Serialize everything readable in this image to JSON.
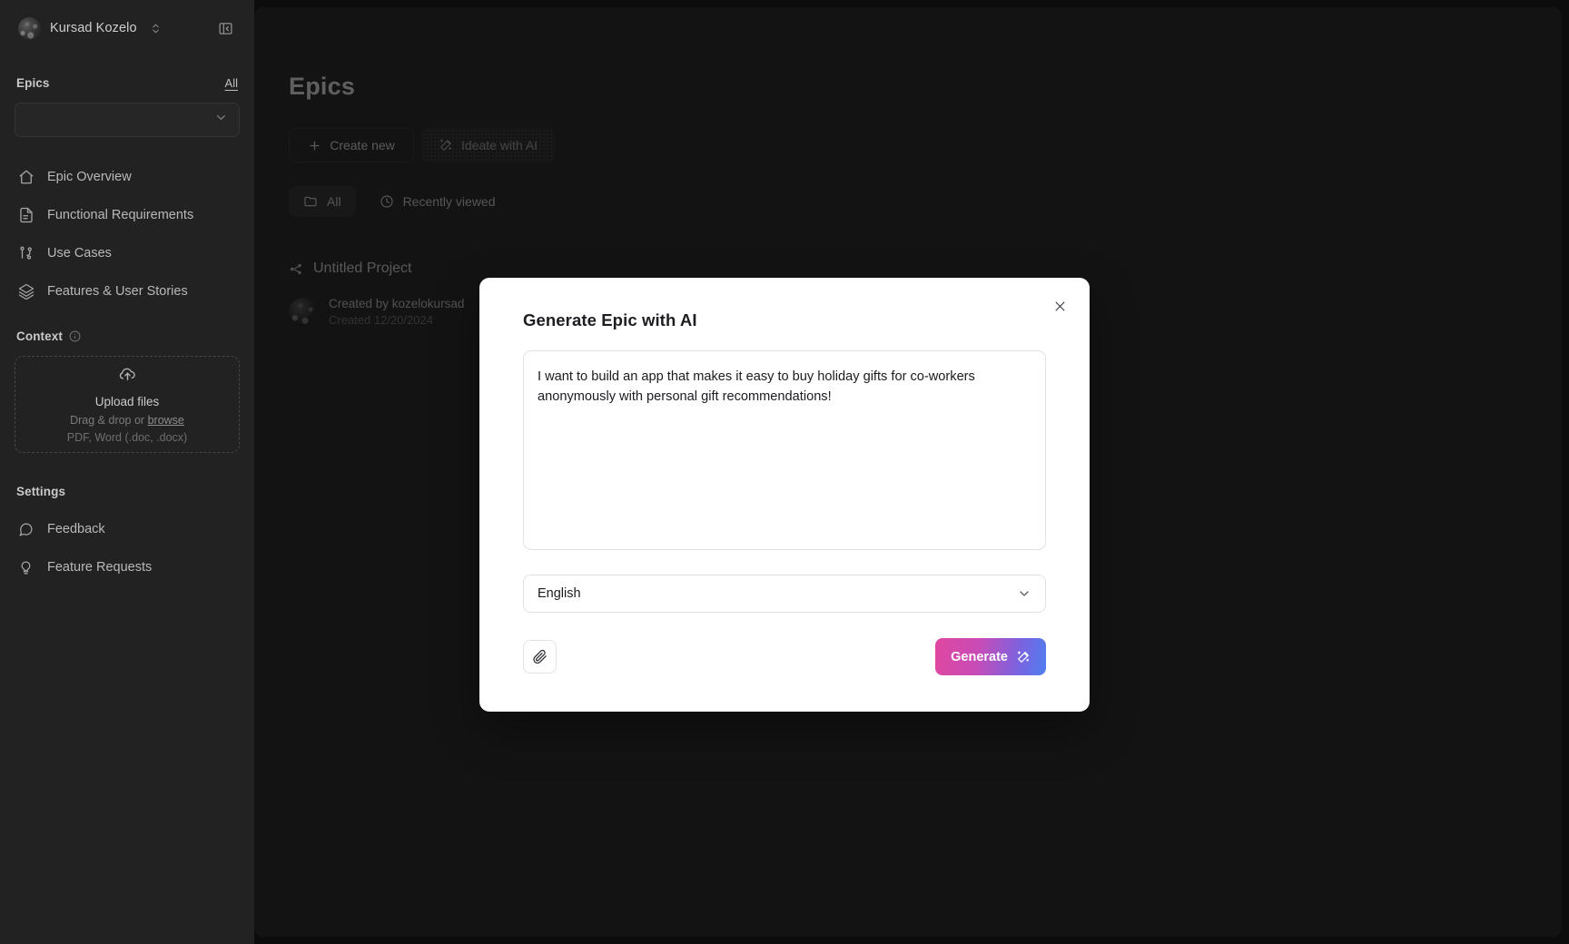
{
  "sidebar": {
    "user": {
      "name": "Kursad Kozelo",
      "avatar_icon": "user-avatar",
      "switcher_icon": "chevron-up-down-icon",
      "collapse_icon": "panel-collapse-icon"
    },
    "epics": {
      "label": "Epics",
      "all_link": "All",
      "select_value": "",
      "select_icon": "chevron-down-icon"
    },
    "nav_items": [
      {
        "label": "Epic Overview",
        "icon": "home-icon"
      },
      {
        "label": "Functional Requirements",
        "icon": "document-icon"
      },
      {
        "label": "Use Cases",
        "icon": "branch-icon"
      },
      {
        "label": "Features & User Stories",
        "icon": "layers-icon"
      }
    ],
    "context": {
      "label": "Context",
      "info_icon": "info-icon",
      "upload_icon": "cloud-upload-icon",
      "upload_title": "Upload files",
      "upload_hint_prefix": "Drag & drop or ",
      "upload_hint_link": "browse",
      "upload_formats": "PDF, Word (.doc, .docx)"
    },
    "settings": {
      "label": "Settings",
      "items": [
        {
          "label": "Feedback",
          "icon": "chat-bubble-icon"
        },
        {
          "label": "Feature Requests",
          "icon": "lightbulb-icon"
        }
      ]
    }
  },
  "main": {
    "page_title": "Epics",
    "actions": {
      "create_new": "Create new",
      "create_new_icon": "plus-icon",
      "ideate_with_ai": "Ideate with AI",
      "ideate_icon": "magic-wand-icon"
    },
    "tabs": [
      {
        "label": "All",
        "icon": "folder-icon",
        "active": true
      },
      {
        "label": "Recently viewed",
        "icon": "clock-icon",
        "active": false
      }
    ],
    "project": {
      "name": "Untitled Project",
      "icon": "project-node-icon",
      "created_by": "Created by kozelokursad",
      "created_date": "Created 12/20/2024",
      "avatar_icon": "user-avatar"
    }
  },
  "modal": {
    "title": "Generate Epic with AI",
    "close_icon": "close-icon",
    "prompt_value": "I want to build an app that makes it easy to buy holiday gifts for co-workers anonymously with personal gift recommendations!",
    "prompt_placeholder": "Describe your epic...",
    "language_value": "English",
    "language_chevron_icon": "chevron-down-icon",
    "attach_icon": "paperclip-icon",
    "generate_label": "Generate",
    "generate_icon": "magic-wand-icon"
  },
  "colors": {
    "accent_pink": "#e0489f",
    "accent_blue": "#4f7ff0",
    "sidebar_bg": "#222222",
    "main_bg": "#2b2b2b",
    "modal_bg": "#ffffff"
  }
}
